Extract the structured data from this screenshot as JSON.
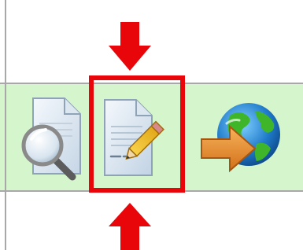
{
  "toolbar": {
    "tools": [
      {
        "id": "preview",
        "icon": "document-magnifier-icon",
        "label": ""
      },
      {
        "id": "edit",
        "icon": "document-pencil-icon",
        "label": ""
      },
      {
        "id": "publish",
        "icon": "globe-arrow-icon",
        "label": ""
      }
    ],
    "highlighted_tool": "edit"
  },
  "colors": {
    "row_background": "#d5f5cd",
    "highlight": "#e8060b",
    "grid_line": "#a8a8a8"
  }
}
